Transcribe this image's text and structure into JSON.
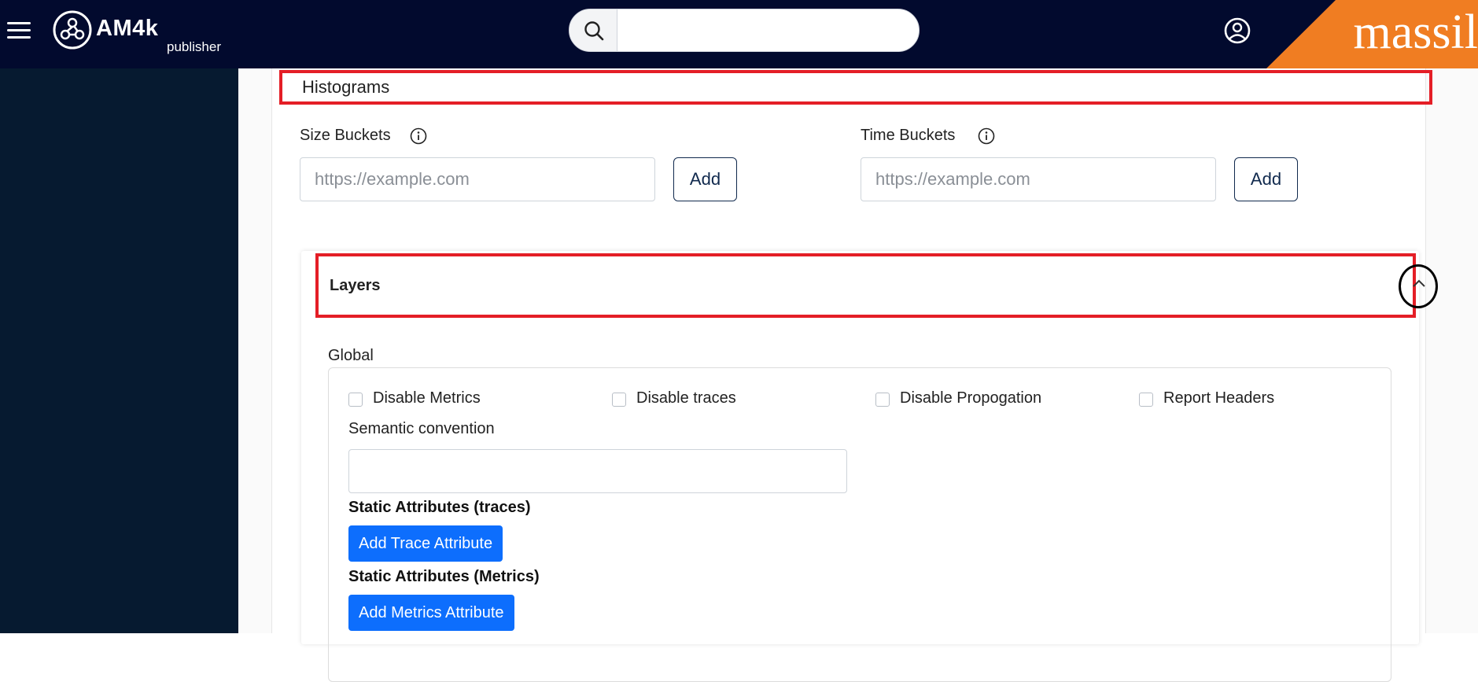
{
  "header": {
    "logo_text": "AM4k",
    "logo_sub": "publisher",
    "search": {
      "placeholder": "",
      "value": ""
    },
    "brand_text": "massil"
  },
  "histograms": {
    "title": "Histograms",
    "size_buckets": {
      "label": "Size Buckets",
      "placeholder": "https://example.com",
      "add_label": "Add"
    },
    "time_buckets": {
      "label": "Time Buckets",
      "placeholder": "https://example.com",
      "add_label": "Add"
    }
  },
  "layers": {
    "title": "Layers",
    "global_label": "Global",
    "checkboxes": [
      {
        "label": "Disable Metrics",
        "checked": false
      },
      {
        "label": "Disable traces",
        "checked": false
      },
      {
        "label": "Disable Propogation",
        "checked": false
      },
      {
        "label": "Report Headers",
        "checked": false
      }
    ],
    "semantic_convention": {
      "label": "Semantic convention",
      "value": ""
    },
    "static_traces": {
      "title": "Static Attributes (traces)",
      "button": "Add Trace Attribute"
    },
    "static_metrics": {
      "title": "Static Attributes (Metrics)",
      "button": "Add Metrics Attribute"
    }
  },
  "colors": {
    "topbar": "#020a2e",
    "sidebar": "#061a30",
    "brand": "#f07d22",
    "highlight": "#e41e26",
    "primary_button": "#0d6efd"
  }
}
